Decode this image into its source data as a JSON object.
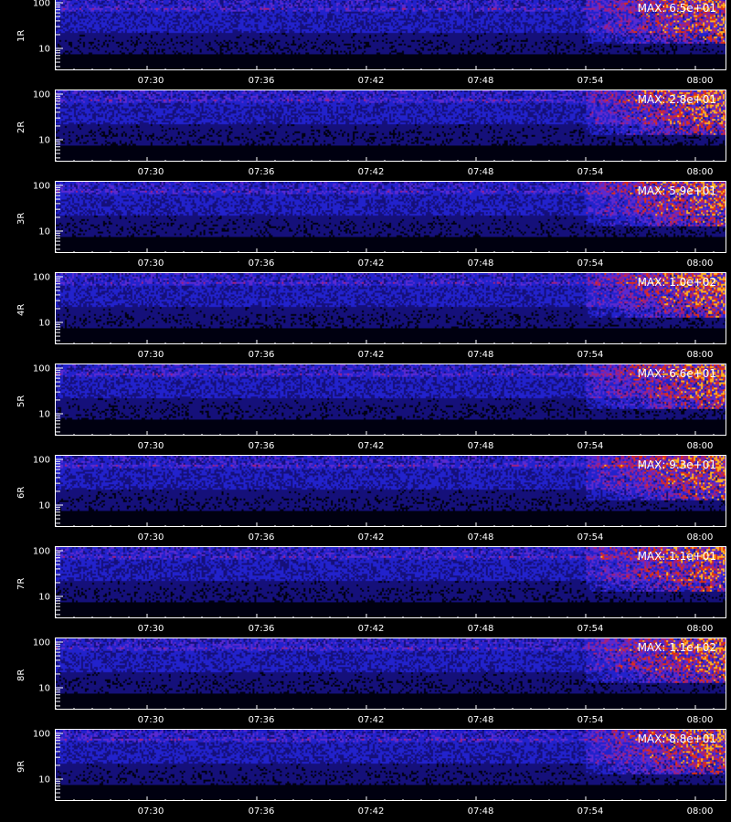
{
  "chart_data": {
    "type": "heatmap",
    "x_ticks": [
      "07:30",
      "07:36",
      "07:42",
      "07:48",
      "07:54",
      "08:00"
    ],
    "y_ticks": [
      "100",
      "10"
    ],
    "y_scale": "log",
    "colormap": "black-blue-red-yellow",
    "panels": [
      {
        "label": "1R",
        "max": "MAX: 6.5e+01"
      },
      {
        "label": "2R",
        "max": "MAX: 2.8e+01"
      },
      {
        "label": "3R",
        "max": "MAX: 5.9e+01"
      },
      {
        "label": "4R",
        "max": "MAX: 1.0e+02"
      },
      {
        "label": "5R",
        "max": "MAX: 6.6e+01"
      },
      {
        "label": "6R",
        "max": "MAX: 9.3e+01"
      },
      {
        "label": "7R",
        "max": "MAX: 1.1e+01"
      },
      {
        "label": "8R",
        "max": "MAX: 1.1e+02"
      },
      {
        "label": "9R",
        "max": "MAX: 8.8e+01"
      }
    ]
  },
  "colors": {
    "background": "#000000",
    "low": "#1a1acc",
    "mid": "#7a2aa0",
    "high": "#e03010",
    "peak": "#ffd020"
  }
}
